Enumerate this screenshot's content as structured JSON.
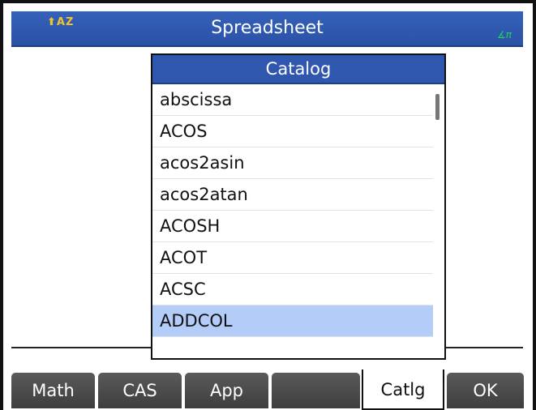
{
  "titlebar": {
    "shift_indicator": "⬆AZ",
    "title": "Spreadsheet",
    "angle_indicator": "∡π"
  },
  "catalog": {
    "title": "Catalog",
    "items": [
      {
        "label": "abscissa",
        "selected": false
      },
      {
        "label": "ACOS",
        "selected": false
      },
      {
        "label": "acos2asin",
        "selected": false
      },
      {
        "label": "acos2atan",
        "selected": false
      },
      {
        "label": "ACOSH",
        "selected": false
      },
      {
        "label": "ACOT",
        "selected": false
      },
      {
        "label": "ACSC",
        "selected": false
      },
      {
        "label": "ADDCOL",
        "selected": true
      }
    ]
  },
  "softkeys": [
    {
      "label": "Math",
      "active": false
    },
    {
      "label": "CAS",
      "active": false
    },
    {
      "label": "App",
      "active": false
    },
    {
      "label": "",
      "active": false
    },
    {
      "label": "Catlg",
      "active": true
    },
    {
      "label": "OK",
      "active": false
    }
  ],
  "colors": {
    "titlebar_blue": "#2a52a7",
    "selection": "#b3cdf8",
    "shift_yellow": "#f2c329",
    "angle_green": "#1fd15c"
  }
}
